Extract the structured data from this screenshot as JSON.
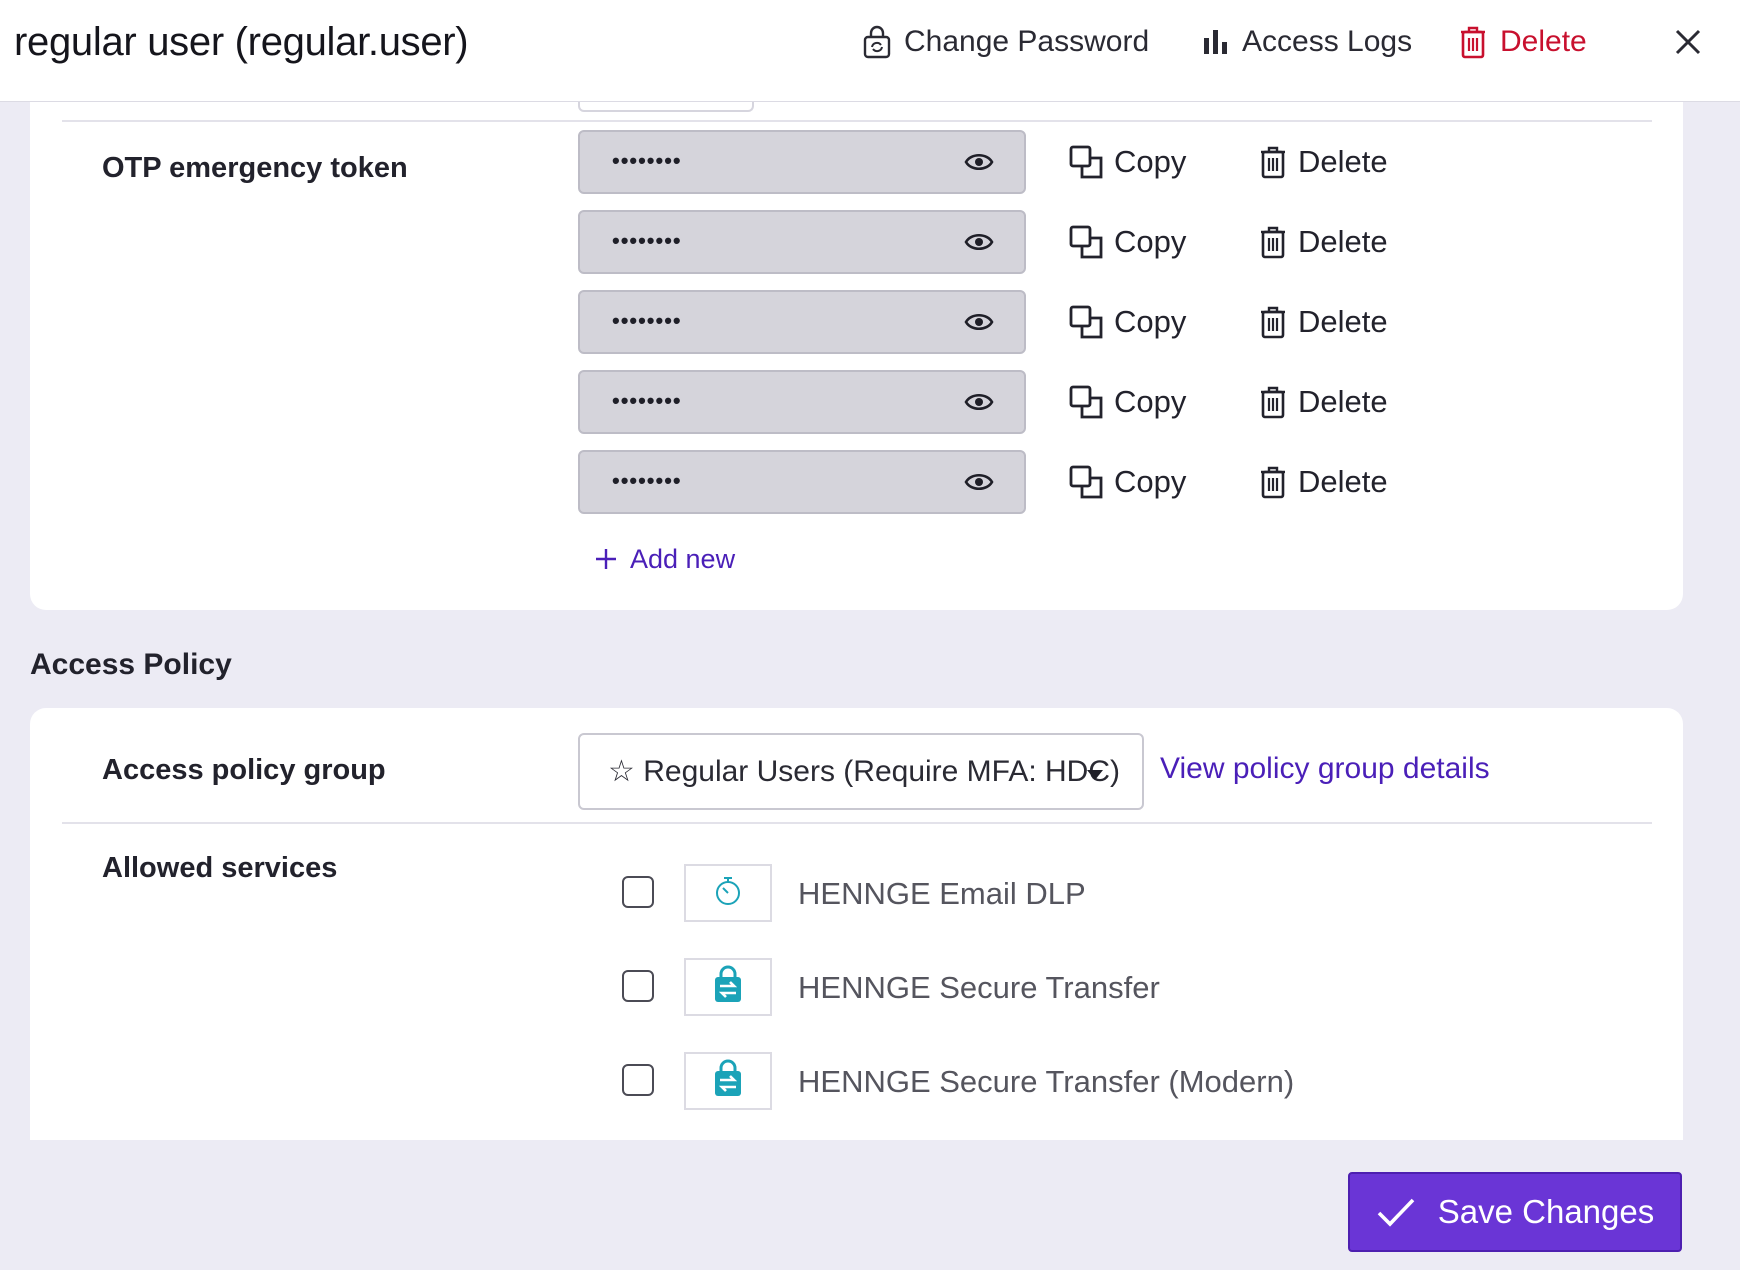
{
  "header": {
    "title": "regular user (regular.user)",
    "change_password": "Change Password",
    "access_logs": "Access Logs",
    "delete": "Delete"
  },
  "otp": {
    "label": "OTP emergency token",
    "tokens": [
      {
        "masked": "••••••••",
        "copy": "Copy",
        "delete": "Delete"
      },
      {
        "masked": "••••••••",
        "copy": "Copy",
        "delete": "Delete"
      },
      {
        "masked": "••••••••",
        "copy": "Copy",
        "delete": "Delete"
      },
      {
        "masked": "••••••••",
        "copy": "Copy",
        "delete": "Delete"
      },
      {
        "masked": "••••••••",
        "copy": "Copy",
        "delete": "Delete"
      }
    ],
    "add_new": "Add new"
  },
  "access_policy": {
    "heading": "Access Policy",
    "group_label": "Access policy group",
    "group_value": "☆ Regular Users (Require MFA: HDC)",
    "view_details": "View policy group details",
    "services_label": "Allowed services",
    "services": [
      {
        "name": "HENNGE Email DLP",
        "icon": "email-dlp-icon",
        "checked": false
      },
      {
        "name": "HENNGE Secure Transfer",
        "icon": "secure-transfer-icon",
        "checked": false
      },
      {
        "name": "HENNGE Secure Transfer (Modern)",
        "icon": "secure-transfer-icon",
        "checked": false
      }
    ]
  },
  "footer": {
    "save": "Save Changes"
  },
  "colors": {
    "accent": "#6a35d6",
    "link": "#4a1fb8",
    "danger": "#c8102e",
    "service_icon": "#1ba3b8"
  }
}
